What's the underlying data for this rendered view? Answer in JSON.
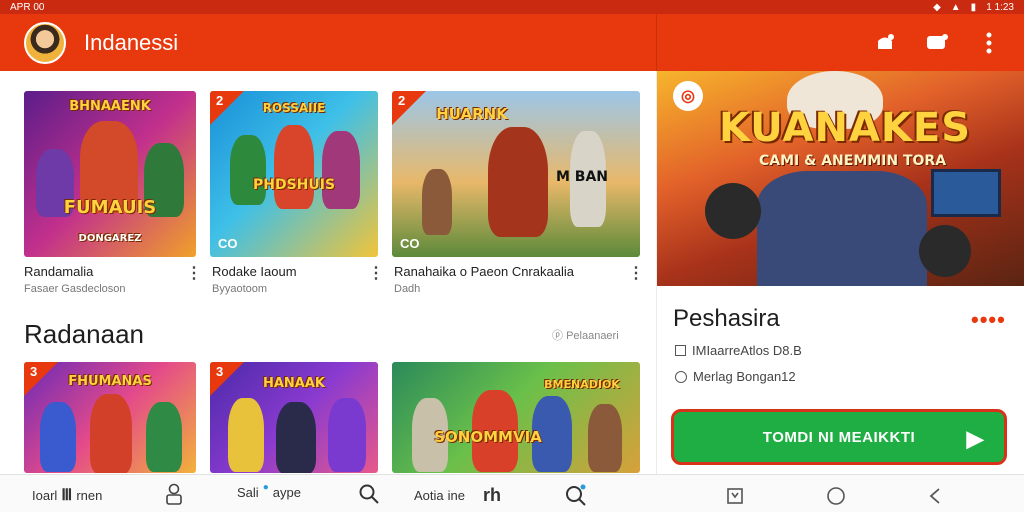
{
  "status_bar": {
    "left_text": "APR 00",
    "right_text": "1 1:23"
  },
  "app": {
    "title": "Indanessi"
  },
  "cards_row1": [
    {
      "title": "Randamalia",
      "subtitle": "Fasaer Gasdecloson",
      "thumb_text": "FUMAUIS",
      "thumb_top_text": "BHNAAENK",
      "thumb_bottom_text": "DONGAREZ",
      "corner_label": "",
      "cc_label": ""
    },
    {
      "title": "Rodake Iaoum",
      "subtitle": "Byyaotoom",
      "thumb_text": "PHDSHUIS",
      "thumb_top_text": "ROSSAIIE",
      "thumb_bottom_text": "",
      "corner_label": "2",
      "cc_label": "CO"
    },
    {
      "title": "Ranahaika o Paeon Cnrakaalia",
      "subtitle": "Dadh",
      "thumb_text": "M BAN",
      "thumb_top_text": "HUARNK",
      "thumb_bottom_text": "",
      "corner_label": "2",
      "cc_label": "CO"
    }
  ],
  "section": {
    "title": "Radanaan",
    "link": "Pelaanaeri"
  },
  "cards_row2": [
    {
      "thumb_text": "FHUMANAS",
      "corner_label": "3"
    },
    {
      "thumb_text": "HANAAK",
      "corner_label": "3"
    },
    {
      "thumb_text": "SONOMMVIA",
      "thumb_top_text": "BMENADIOK",
      "corner_label": ""
    }
  ],
  "bottom_nav": [
    {
      "label": "Ioarl",
      "suffix": "rnen",
      "icon": "home-icon"
    },
    {
      "label": "",
      "suffix": "",
      "icon": "person-icon"
    },
    {
      "label": "Sali",
      "suffix": "aype",
      "icon": "search-icon"
    },
    {
      "label": "",
      "suffix": "",
      "icon": "search-icon"
    },
    {
      "label": "Aotia",
      "suffix": "ine",
      "icon": "library-icon"
    },
    {
      "label": "",
      "suffix": "",
      "icon": "search-icon"
    }
  ],
  "detail": {
    "hero_title": "KUANAKES",
    "hero_subtitle": "CAMI & ANEMMIN TORA",
    "title": "Peshasira",
    "meta1": "IMIaarreAtlos D8.B",
    "meta2": "Merlag Bongan12",
    "install_label": "TOMDI NI MEAIKKTI"
  },
  "colors": {
    "accent": "#e8380d",
    "install": "#1fae43"
  }
}
